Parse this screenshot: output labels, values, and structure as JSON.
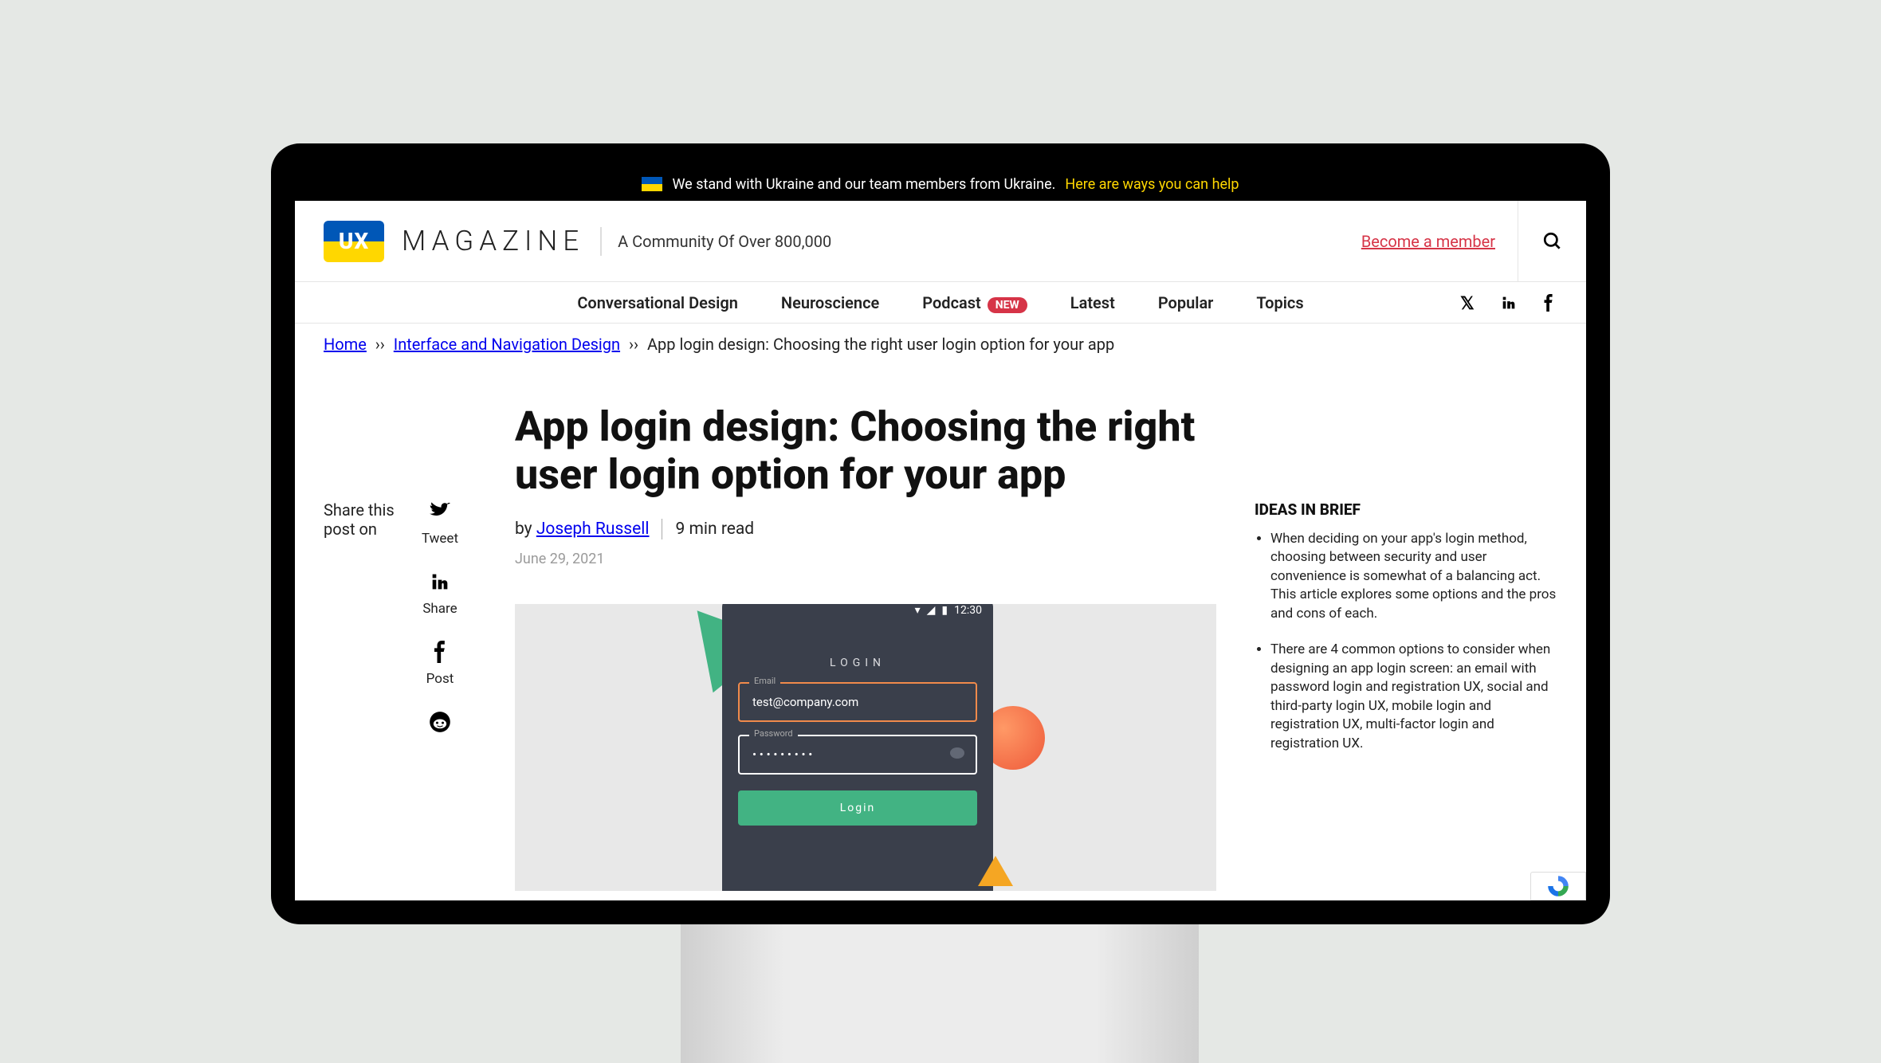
{
  "banner": {
    "text": "We stand with Ukraine and our team members from Ukraine.",
    "link": "Here are ways you can help"
  },
  "header": {
    "logo_abbrev": "UX",
    "logo_word": "MAGAZINE",
    "tagline": "A Community Of Over 800,000",
    "cta": "Become a member"
  },
  "nav": {
    "items": [
      "Conversational Design",
      "Neuroscience",
      "Podcast",
      "Latest",
      "Popular",
      "Topics"
    ],
    "new_badge": "NEW"
  },
  "crumbs": {
    "home": "Home",
    "cat": "Interface and Navigation Design",
    "page": "App login design: Choosing the right user login option for your app",
    "sep": "››"
  },
  "share": {
    "label": "Share this post on",
    "twitter": "Tweet",
    "linkedin": "Share",
    "facebook": "Post"
  },
  "article": {
    "title": "App login design: Choosing the right user login option for your app",
    "by_prefix": "by ",
    "author": "Joseph Russell",
    "read": "9 min read",
    "date": "June 29, 2021"
  },
  "hero": {
    "time": "12:30",
    "title": "LOGIN",
    "email_label": "Email",
    "email_value": "test@company.com",
    "pw_label": "Password",
    "pw_value": "• • • • • • • • •",
    "button": "Login"
  },
  "iib": {
    "title": "IDEAS IN BRIEF",
    "items": [
      "When deciding on your app's login method, choosing between security and user convenience is somewhat of a balancing act. This article explores some options and the pros and cons of each.",
      "There are 4 common options to consider when designing an app login screen: an email with password login and registration UX, social and third-party login UX, mobile login and registration UX, multi-factor login and registration UX."
    ]
  }
}
